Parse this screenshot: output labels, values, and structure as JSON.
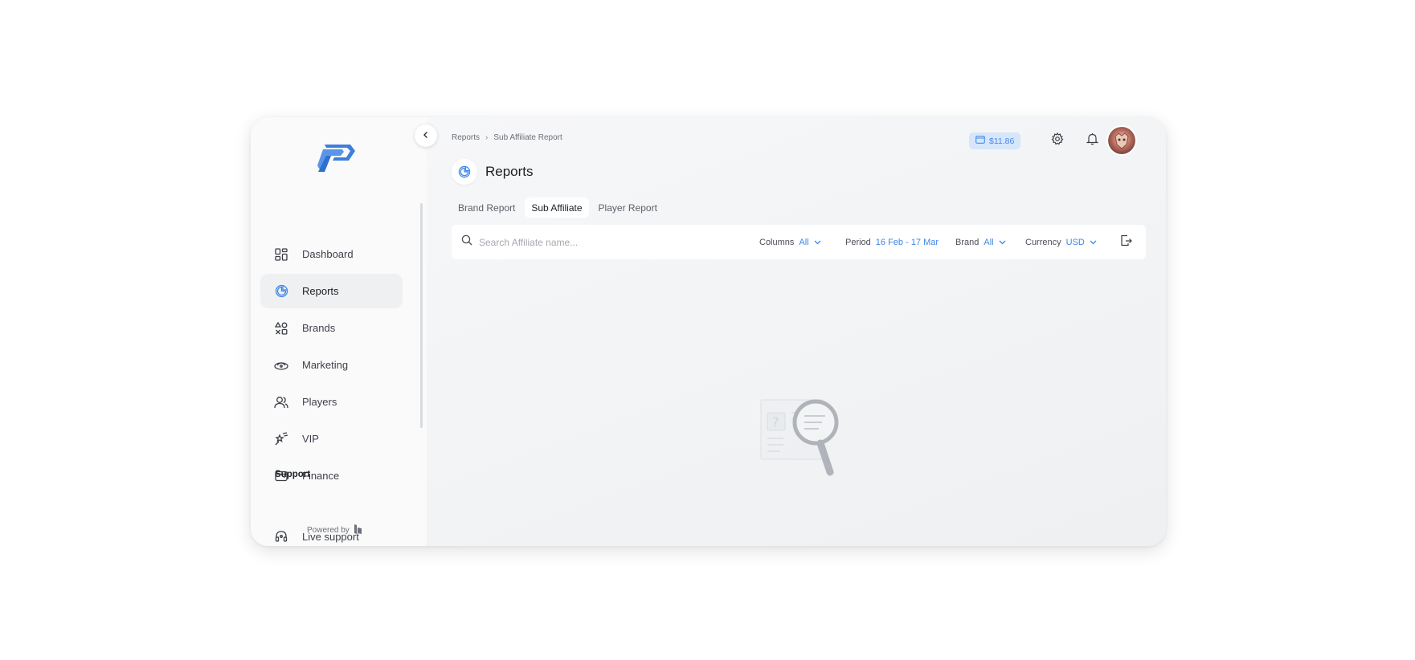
{
  "sidebar": {
    "logo_icon": "brand-logo",
    "items": [
      {
        "label": "Dashboard",
        "icon": "dashboard-icon",
        "active": false
      },
      {
        "label": "Reports",
        "icon": "reports-icon",
        "active": true
      },
      {
        "label": "Brands",
        "icon": "brands-icon",
        "active": false
      },
      {
        "label": "Marketing",
        "icon": "marketing-icon",
        "active": false
      },
      {
        "label": "Players",
        "icon": "players-icon",
        "active": false
      },
      {
        "label": "VIP",
        "icon": "vip-icon",
        "active": false
      },
      {
        "label": "Finance",
        "icon": "finance-icon",
        "active": false
      }
    ],
    "support_title": "Support",
    "support_items": [
      {
        "label": "Live support",
        "icon": "headset-icon"
      }
    ],
    "powered_by": "Powered by"
  },
  "header": {
    "breadcrumb": [
      "Reports",
      "Sub Affiliate Report"
    ],
    "balance": "$11.86",
    "accent_color": "#3d86e8"
  },
  "page": {
    "title": "Reports",
    "tabs": [
      {
        "label": "Brand Report",
        "active": false
      },
      {
        "label": "Sub Affiliate",
        "active": true
      },
      {
        "label": "Player Report",
        "active": false
      }
    ]
  },
  "toolbar": {
    "search_placeholder": "Search Affiliate name...",
    "columns_label": "Columns",
    "columns_value": "All",
    "period_label": "Period",
    "period_value": "16 Feb - 17 Mar",
    "brand_label": "Brand",
    "brand_value": "All",
    "currency_label": "Currency",
    "currency_value": "USD"
  }
}
